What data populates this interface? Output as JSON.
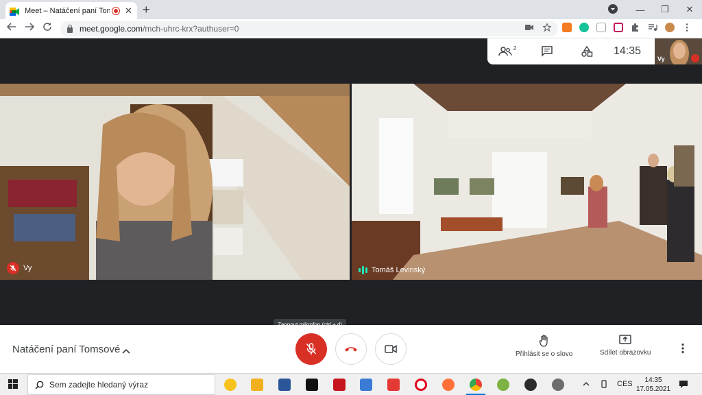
{
  "browser": {
    "tab_title": "Meet – Natáčení paní Tomsové",
    "new_tab": "+",
    "close_tab": "✕",
    "url_host": "meet.google.com",
    "url_path": "/mch-uhrc-krx?authuser=0",
    "window": {
      "minimize": "—",
      "restore": "❐",
      "close": "✕"
    }
  },
  "meet": {
    "participant_count_badge": "2",
    "clock": "14:35",
    "self_label": "Vy",
    "tiles": [
      {
        "name": "Vy",
        "muted": true
      },
      {
        "name": "Tomáš Levinský",
        "speaking": true
      }
    ]
  },
  "bottom_bar": {
    "meeting_title": "Natáčení paní Tomsové",
    "tooltip": "Zapnout mikrofon (ctrl + d)",
    "raise_hand": "Přihlásit se o slovo",
    "present": "Sdílet obrazovku"
  },
  "taskbar": {
    "search_placeholder": "Sem zadejte hledaný výraz",
    "language": "CES",
    "time": "14:35",
    "date": "17.05.2021"
  },
  "colors": {
    "accent_red": "#d93025",
    "speaking_green": "#1de9b6",
    "taskbar_active": "#0078d7"
  }
}
